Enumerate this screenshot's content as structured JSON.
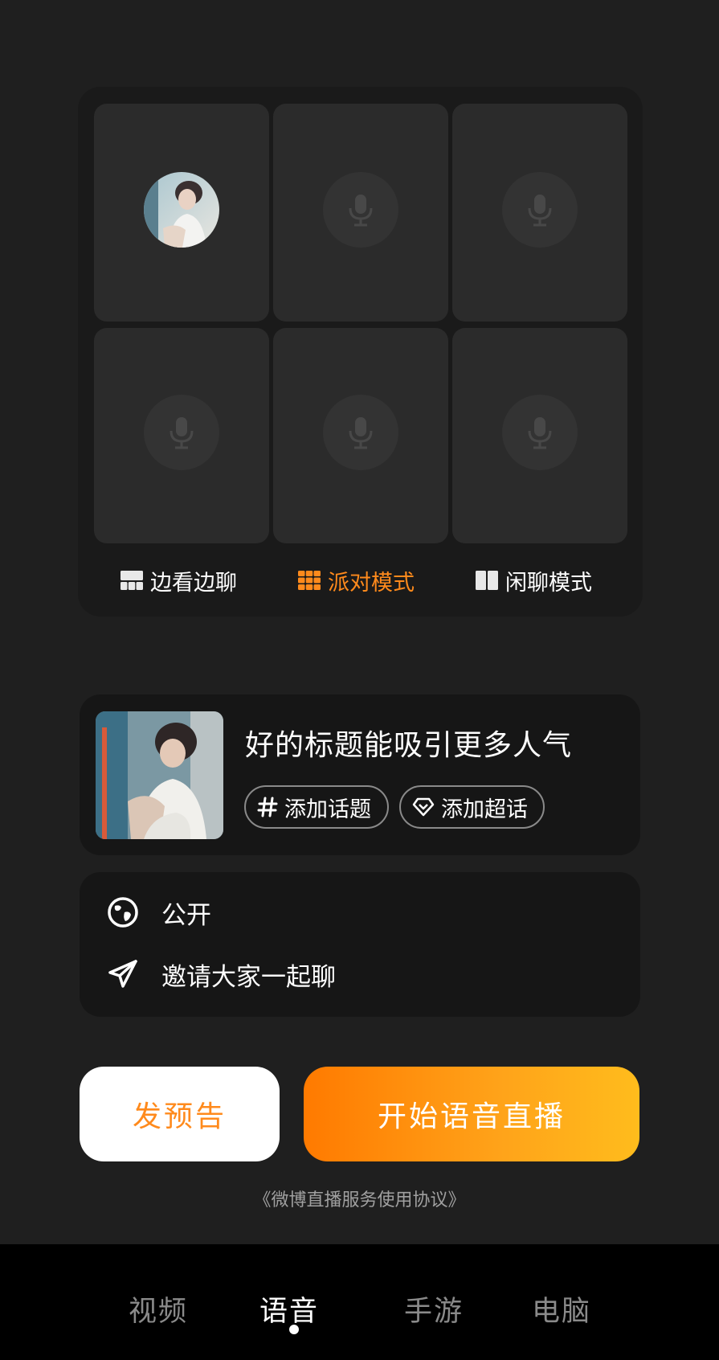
{
  "seat_modes": [
    {
      "label": "边看边聊",
      "icon": "watch-chat-layout-icon",
      "active": false
    },
    {
      "label": "派对模式",
      "icon": "party-grid-layout-icon",
      "active": true
    },
    {
      "label": "闲聊模式",
      "icon": "chat-split-layout-icon",
      "active": false
    }
  ],
  "title_card": {
    "title_placeholder": "好的标题能吸引更多人气",
    "topic_chip": "添加话题",
    "supertopic_chip": "添加超话"
  },
  "settings": {
    "visibility": "公开",
    "invite": "邀请大家一起聊"
  },
  "buttons": {
    "preview": "发预告",
    "start": "开始语音直播"
  },
  "agreement": "《微博直播服务使用协议》",
  "tabs": [
    {
      "label": "视频",
      "active": false
    },
    {
      "label": "语音",
      "active": true
    },
    {
      "label": "手游",
      "active": false
    },
    {
      "label": "电脑",
      "active": false
    }
  ],
  "colors": {
    "accent": "#ff8a1c",
    "background": "#1f1f1f",
    "card": "#161616"
  }
}
